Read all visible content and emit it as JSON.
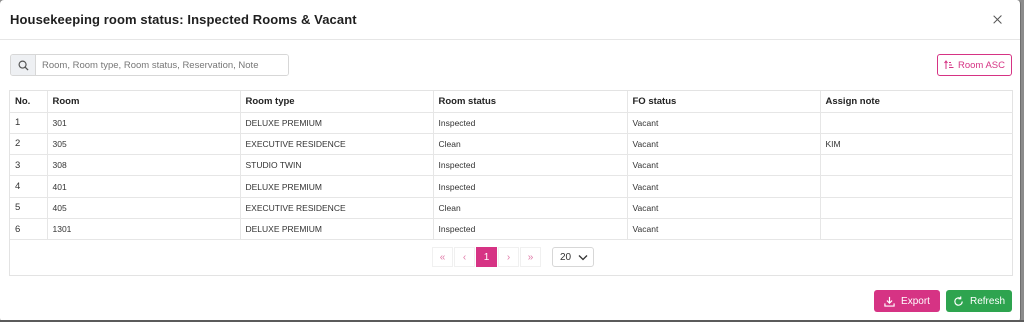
{
  "modal": {
    "title": "Housekeeping room status: Inspected Rooms & Vacant"
  },
  "search": {
    "placeholder": "Room, Room type, Room status, Reservation, Note",
    "value": ""
  },
  "sort_button": {
    "label": "Room ASC"
  },
  "table": {
    "columns": [
      "No.",
      "Room",
      "Room type",
      "Room status",
      "FO status",
      "Assign note"
    ],
    "rows": [
      [
        "1",
        "301",
        "DELUXE PREMIUM",
        "Inspected",
        "Vacant",
        ""
      ],
      [
        "2",
        "305",
        "EXECUTIVE RESIDENCE",
        "Clean",
        "Vacant",
        "KIM"
      ],
      [
        "3",
        "308",
        "STUDIO TWIN",
        "Inspected",
        "Vacant",
        ""
      ],
      [
        "4",
        "401",
        "DELUXE PREMIUM",
        "Inspected",
        "Vacant",
        ""
      ],
      [
        "5",
        "405",
        "EXECUTIVE RESIDENCE",
        "Clean",
        "Vacant",
        ""
      ],
      [
        "6",
        "1301",
        "DELUXE PREMIUM",
        "Inspected",
        "Vacant",
        ""
      ]
    ]
  },
  "pagination": {
    "first": "«",
    "prev": "‹",
    "current": "1",
    "next": "›",
    "last": "»",
    "page_size": "20"
  },
  "footer": {
    "export_label": "Export",
    "refresh_label": "Refresh"
  },
  "colors": {
    "accent": "#d63384",
    "success": "#2ea44f"
  }
}
